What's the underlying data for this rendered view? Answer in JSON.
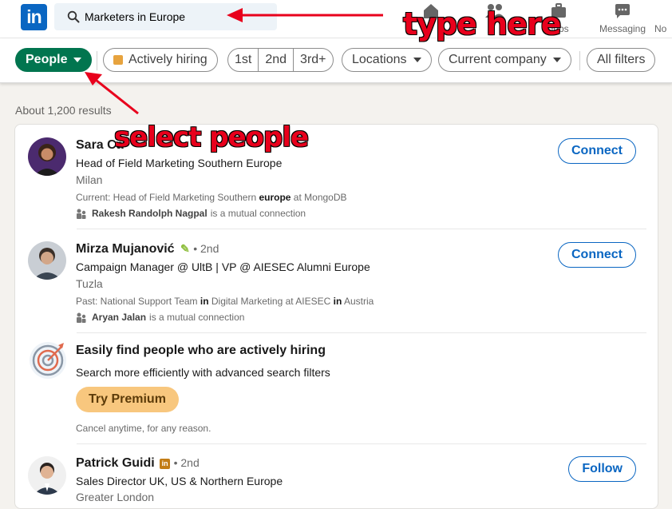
{
  "topnav": {
    "logo": "in",
    "search_value": "Marketers in Europe",
    "jobs_label": "Jobs",
    "messaging_label": "Messaging",
    "notifications_label": "No"
  },
  "filters": {
    "people_label": "People",
    "actively_hiring_label": "Actively hiring",
    "degrees": [
      "1st",
      "2nd",
      "3rd+"
    ],
    "locations_label": "Locations",
    "current_company_label": "Current company",
    "all_filters_label": "All filters"
  },
  "results_count": "About 1,200 results",
  "results": [
    {
      "name": "Sara Ca",
      "headline": "Head of Field Marketing Southern Europe",
      "location": "Milan",
      "summary_prefix": "Current: Head of Field Marketing Southern ",
      "summary_bold": "europe",
      "summary_suffix": " at MongoDB",
      "mutual_name": "Rakesh Randolph Nagpal",
      "mutual_text": "is a mutual connection",
      "action": "Connect"
    },
    {
      "name": "Mirza Mujanović",
      "degree": "• 2nd",
      "headline": "Campaign Manager @ UltB | VP @ AIESEC Alumni Europe",
      "location": "Tuzla",
      "summary_a": "Past: National Support Team ",
      "summary_b": "in",
      "summary_c": " Digital Marketing at AIESEC ",
      "summary_d": "in",
      "summary_e": " Austria",
      "mutual_name": "Aryan Jalan",
      "mutual_text": "is a mutual connection",
      "action": "Connect"
    },
    {
      "name": "Patrick Guidi",
      "degree": "• 2nd",
      "headline": "Sales Director UK, US & Northern Europe",
      "location": "Greater London",
      "action": "Follow"
    }
  ],
  "promo": {
    "title": "Easily find people who are actively hiring",
    "subtitle": "Search more efficiently with advanced search filters",
    "button": "Try Premium",
    "note": "Cancel anytime, for any reason."
  },
  "annotations": {
    "type_here": "type here",
    "select_people": "select people"
  },
  "colors": {
    "brand": "#0a66c2",
    "people_pill": "#01754f",
    "annotation": "#e8001c",
    "premium": "#f8c77e"
  }
}
